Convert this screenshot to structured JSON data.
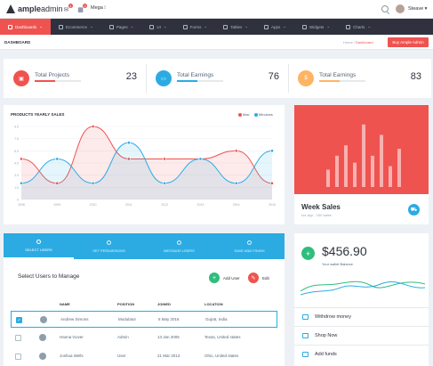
{
  "brand": {
    "bold": "ample",
    "light": "admin"
  },
  "topbar": {
    "mega_label": "Mega",
    "notif_count_1": "1",
    "notif_count_2": "2",
    "user_name": "Steave"
  },
  "nav": [
    {
      "label": "Dashboards",
      "active": true
    },
    {
      "label": "Ecommerce"
    },
    {
      "label": "Pages"
    },
    {
      "label": "UI"
    },
    {
      "label": "Forms"
    },
    {
      "label": "Tables"
    },
    {
      "label": "Apps"
    },
    {
      "label": "Widgets"
    },
    {
      "label": "Charts"
    }
  ],
  "page": {
    "title": "DASHBOARD",
    "breadcrumb_home": "Home",
    "breadcrumb_current": "Dashboard",
    "buy_label": "Buy Ample Admin"
  },
  "stats": [
    {
      "label": "Total Projects",
      "value": "23",
      "color": "#ef5350",
      "progress": 0.45,
      "icon": "briefcase-icon",
      "glyph": "▣"
    },
    {
      "label": "Total Earnings",
      "value": "76",
      "color": "#2cabe3",
      "progress": 0.45,
      "icon": "wallet-icon",
      "glyph": "▭"
    },
    {
      "label": "Total Earnings",
      "value": "83",
      "color": "#ffb463",
      "progress": 0.45,
      "icon": "dollar-icon",
      "glyph": "$"
    }
  ],
  "chart": {
    "title": "PRODUCTS YEARLY SALES",
    "legend_mac": "Mac",
    "legend_windows": "Windows"
  },
  "chart_data": {
    "type": "line",
    "title": "PRODUCTS YEARLY SALES",
    "x": [
      "2008",
      "2009",
      "2010",
      "2011",
      "2012",
      "2013",
      "2014",
      "2015"
    ],
    "yticks": [
      "0",
      "1.5",
      "3.0",
      "4.5",
      "6.0",
      "7.5",
      "9.0"
    ],
    "ylim": [
      0,
      9
    ],
    "series": [
      {
        "name": "Mac",
        "color": "#ef5350",
        "values": [
          5,
          2,
          9,
          5,
          5,
          5,
          6,
          2
        ]
      },
      {
        "name": "Windows",
        "color": "#2cabe3",
        "values": [
          2,
          5,
          2,
          7,
          2,
          5,
          2,
          6
        ]
      }
    ]
  },
  "week_sales": {
    "title": "Week Sales",
    "subtitle": "Ios app - 160 sales",
    "bar_heights": [
      0.25,
      0.45,
      0.6,
      0.35,
      0.9,
      0.45,
      0.75,
      0.3,
      0.55
    ]
  },
  "users": {
    "tabs": [
      {
        "label": "SELECT USERS",
        "active": true
      },
      {
        "label": "SET PERMISSIONS"
      },
      {
        "label": "MESSAGE USERS"
      },
      {
        "label": "SAVE AND FINISH"
      }
    ],
    "title": "Select Users to Manage",
    "add_label": "Add User",
    "edit_label": "Edit",
    "columns": [
      "NAME",
      "POSITION",
      "JOINED",
      "LOCATION"
    ],
    "rows": [
      {
        "name": "Andrew Simons",
        "position": "Modulator",
        "joined": "6 May 2016",
        "location": "Gujrat, India",
        "selected": true
      },
      {
        "name": "Hanna Gover",
        "position": "Admin",
        "joined": "13 Jan 2005",
        "location": "Texas, United states",
        "selected": false
      },
      {
        "name": "Joshua Wells",
        "position": "User",
        "joined": "21 Mar 2013",
        "location": "Ohio, United states",
        "selected": false
      }
    ]
  },
  "balance": {
    "amount": "$456.90",
    "subtitle": "Your wallet Balance",
    "items": [
      "Withdrow money",
      "Shop Now",
      "Add funds"
    ]
  },
  "colors": {
    "accent_red": "#ef5350",
    "accent_blue": "#2cabe3",
    "accent_green": "#2fbe7d",
    "nav_bg": "#2f323e"
  }
}
